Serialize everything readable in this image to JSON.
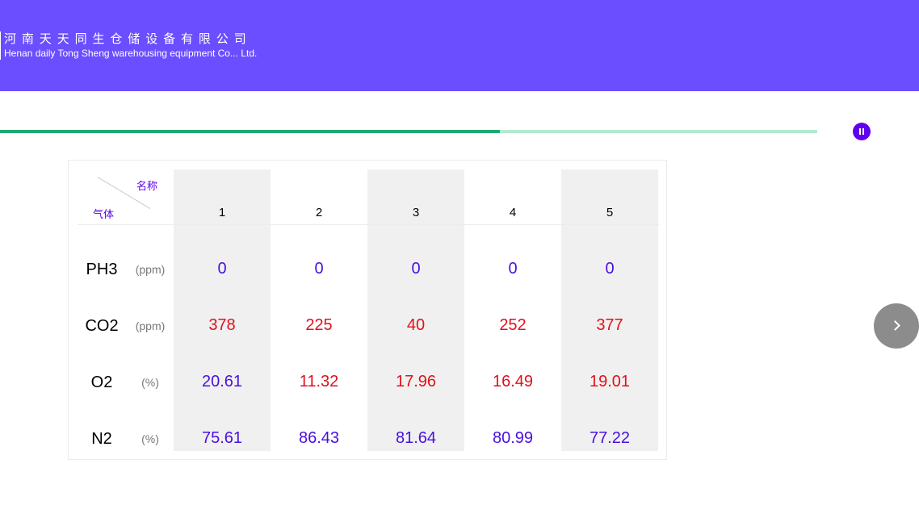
{
  "company": {
    "name_cn": "河南天天同生仓储设备有限公司",
    "name_en": "Henan daily Tong Sheng warehousing equipment Co... Ltd."
  },
  "progress": {
    "fraction": 0.612
  },
  "table": {
    "corner": {
      "name_label": "名称",
      "gas_label": "气体"
    },
    "columns": [
      "1",
      "2",
      "3",
      "4",
      "5"
    ],
    "rows": [
      {
        "gas": "PH3",
        "unit": "(ppm)",
        "values": [
          "0",
          "0",
          "0",
          "0",
          "0"
        ],
        "colors": [
          "blue",
          "blue",
          "blue",
          "blue",
          "blue"
        ]
      },
      {
        "gas": "CO2",
        "unit": "(ppm)",
        "values": [
          "378",
          "225",
          "40",
          "252",
          "377"
        ],
        "colors": [
          "red",
          "red",
          "red",
          "red",
          "red"
        ]
      },
      {
        "gas": "O2",
        "unit": "(%)",
        "values": [
          "20.61",
          "11.32",
          "17.96",
          "16.49",
          "19.01"
        ],
        "colors": [
          "blue",
          "red",
          "red",
          "red",
          "red"
        ]
      },
      {
        "gas": "N2",
        "unit": "(%)",
        "values": [
          "75.61",
          "86.43",
          "81.64",
          "80.99",
          "77.22"
        ],
        "colors": [
          "blue",
          "blue",
          "blue",
          "blue",
          "blue"
        ]
      }
    ]
  },
  "colors": {
    "header": "#6a4eff",
    "accent": "#6100ee",
    "progress": "#1faa6f",
    "value_blue": "#4a10e0",
    "value_red": "#e0111b"
  },
  "icons": {
    "pause": "pause-icon",
    "next": "chevron-right-icon"
  }
}
